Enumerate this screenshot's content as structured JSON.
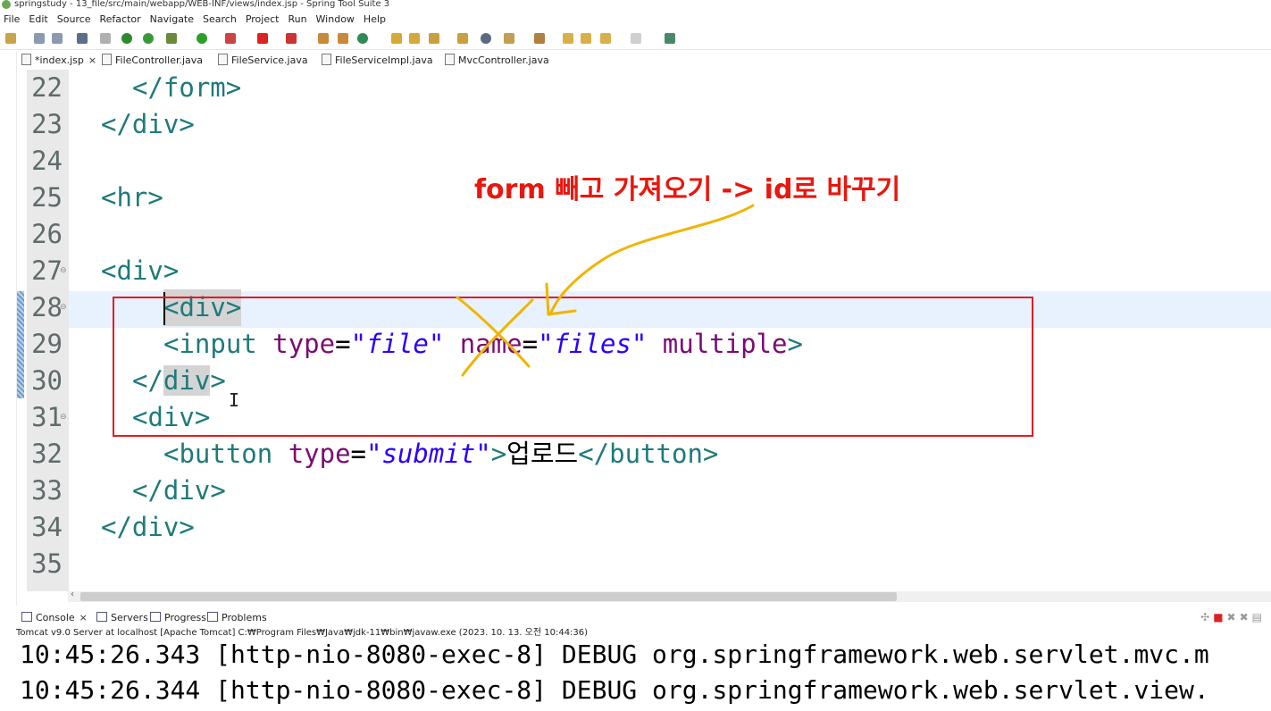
{
  "window": {
    "title": "springstudy - 13_file/src/main/webapp/WEB-INF/views/index.jsp - Spring Tool Suite 3"
  },
  "menu": [
    "File",
    "Edit",
    "Source",
    "Refactor",
    "Navigate",
    "Search",
    "Project",
    "Run",
    "Window",
    "Help"
  ],
  "editor_tabs": [
    {
      "label": "*index.jsp",
      "close": "×"
    },
    {
      "label": "FileController.java"
    },
    {
      "label": "FileService.java"
    },
    {
      "label": "FileServiceImpl.java"
    },
    {
      "label": "MvcController.java"
    }
  ],
  "code_lines": [
    {
      "num": "22",
      "text": "    </form>"
    },
    {
      "num": "23",
      "text": "  </div>"
    },
    {
      "num": "24",
      "text": ""
    },
    {
      "num": "25",
      "text": "  <hr>"
    },
    {
      "num": "26",
      "text": ""
    },
    {
      "num": "27",
      "text": "  <div>"
    },
    {
      "num": "28",
      "text": "      <div>"
    },
    {
      "num": "29",
      "text": "      <input type=\"file\" name=\"files\" multiple>"
    },
    {
      "num": "30",
      "text": "    </div>"
    },
    {
      "num": "31",
      "text": "    <div>"
    },
    {
      "num": "32",
      "text": "      <button type=\"submit\">업로드</button>"
    },
    {
      "num": "33",
      "text": "    </div>"
    },
    {
      "num": "34",
      "text": "  </div>"
    },
    {
      "num": "35",
      "text": ""
    }
  ],
  "tokens": {
    "lt": "<",
    "gt": ">",
    "lt_slash": "</",
    "form": "form",
    "div": "div",
    "hr": "hr",
    "input": "input",
    "button": "button",
    "type": "type",
    "name": "name",
    "multiple": "multiple",
    "eq": "=",
    "file_val": "\"file\"",
    "files_val": "\"files\"",
    "submit_val": "\"submit\"",
    "upload_text": "업로드"
  },
  "annotation": {
    "text": "form 빼고 가져오기 -> id로 바꾸기"
  },
  "console_tabs": [
    {
      "label": "Console",
      "close": "×"
    },
    {
      "label": "Servers"
    },
    {
      "label": "Progress"
    },
    {
      "label": "Problems"
    }
  ],
  "console": {
    "header": "Tomcat v9.0 Server at localhost [Apache Tomcat] C:₩Program Files₩Java₩jdk-11₩bin₩javaw.exe  (2023. 10. 13. 오전 10:44:36)",
    "lines": [
      "10:45:26.343 [http-nio-8080-exec-8] DEBUG org.springframework.web.servlet.mvc.m",
      "10:45:26.344 [http-nio-8080-exec-8] DEBUG org.springframework.web.servlet.view."
    ]
  },
  "colors": {
    "annotation": "#e8170f",
    "highlight_box": "#e41b23",
    "pen_strokes": "#f0b400",
    "tag": "#1f7a7a",
    "attribute": "#7a0a72",
    "string": "#2a00ff"
  }
}
